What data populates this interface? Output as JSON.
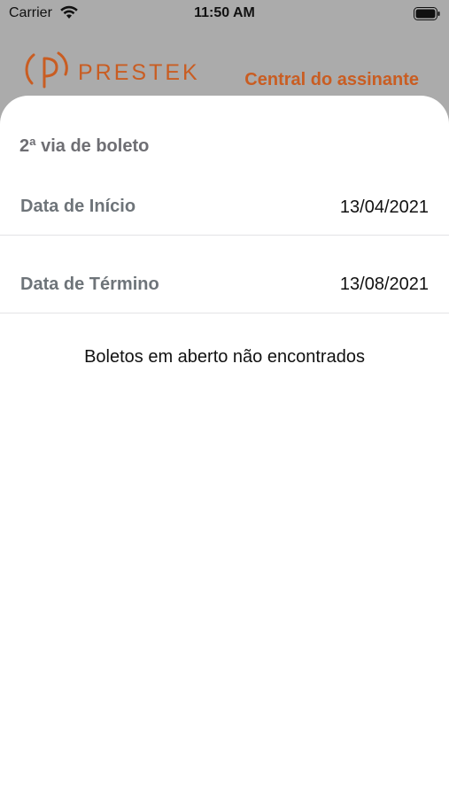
{
  "status_bar": {
    "carrier": "Carrier",
    "time": "11:50 AM",
    "wifi_icon": "wifi-icon",
    "battery_icon": "battery-icon"
  },
  "header": {
    "brand": "PRESTEK",
    "subtitle": "Central do assinante",
    "brand_color": "#c95d22"
  },
  "sheet": {
    "title": "2ª via de boleto",
    "start_row": {
      "label": "Data de Início",
      "value": "13/04/2021"
    },
    "end_row": {
      "label": "Data de Término",
      "value": "13/08/2021"
    },
    "empty_message": "Boletos em aberto não encontrados"
  }
}
